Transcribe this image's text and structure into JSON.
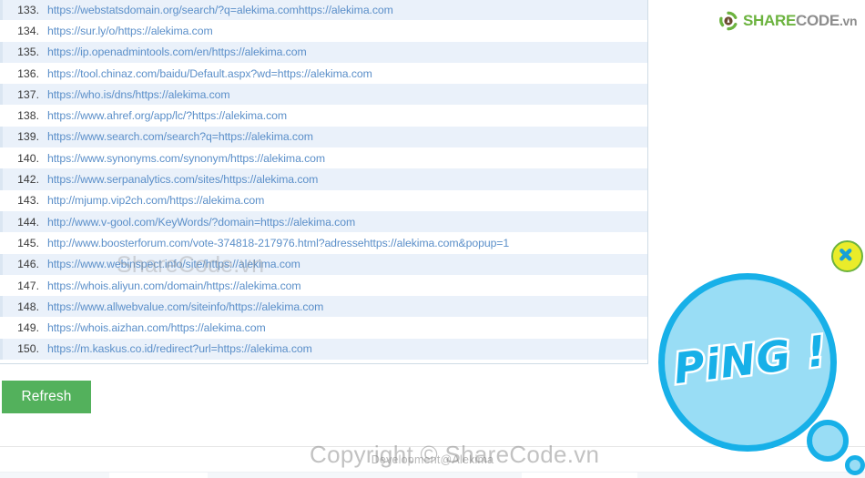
{
  "app": {
    "footer_text": "Development@Alekima",
    "watermark_main": "Copyright © ShareCode.vn",
    "watermark_list": "ShareCode.vn"
  },
  "logo": {
    "icon": "recycle-leaf-icon",
    "part_green": "SHARE",
    "part_grey": "CODE",
    "part_tld": ".vn",
    "colors": {
      "green": "#6cb33f",
      "grey": "#8d8d8d"
    }
  },
  "toolbar": {
    "refresh_label": "Refresh",
    "refresh_color": "#53b15c"
  },
  "backlinks": {
    "rows": [
      {
        "index": "133.",
        "url": "https://webstatsdomain.org/search/?q=alekima.comhttps://alekima.com"
      },
      {
        "index": "134.",
        "url": "https://sur.ly/o/https://alekima.com"
      },
      {
        "index": "135.",
        "url": "https://ip.openadmintools.com/en/https://alekima.com"
      },
      {
        "index": "136.",
        "url": "https://tool.chinaz.com/baidu/Default.aspx?wd=https://alekima.com"
      },
      {
        "index": "137.",
        "url": "https://who.is/dns/https://alekima.com"
      },
      {
        "index": "138.",
        "url": "https://www.ahref.org/app/lc/?https://alekima.com"
      },
      {
        "index": "139.",
        "url": "https://www.search.com/search?q=https://alekima.com"
      },
      {
        "index": "140.",
        "url": "https://www.synonyms.com/synonym/https://alekima.com"
      },
      {
        "index": "142.",
        "url": "https://www.serpanalytics.com/sites/https://alekima.com"
      },
      {
        "index": "143.",
        "url": "http://mjump.vip2ch.com/https://alekima.com"
      },
      {
        "index": "144.",
        "url": "http://www.v-gool.com/KeyWords/?domain=https://alekima.com"
      },
      {
        "index": "145.",
        "url": "http://www.boosterforum.com/vote-374818-217976.html?adressehttps://alekima.com&popup=1"
      },
      {
        "index": "146.",
        "url": "https://www.webinspect.info/site/https://alekima.com"
      },
      {
        "index": "147.",
        "url": "https://whois.aliyun.com/domain/https://alekima.com"
      },
      {
        "index": "148.",
        "url": "https://www.allwebvalue.com/siteinfo/https://alekima.com"
      },
      {
        "index": "149.",
        "url": "https://whois.aizhan.com/https://alekima.com"
      },
      {
        "index": "150.",
        "url": "https://m.kaskus.co.id/redirect?url=https://alekima.com"
      }
    ],
    "link_color": "#5b8fc9",
    "stripe_color": "#eaf1fa"
  },
  "advertisement": {
    "bubble_text": "PiNG !",
    "bubble_fill": "#99ddf5",
    "bubble_stroke": "#17b0e8",
    "close_icon": "close-x-icon",
    "close_fill": "#eaec2a"
  }
}
